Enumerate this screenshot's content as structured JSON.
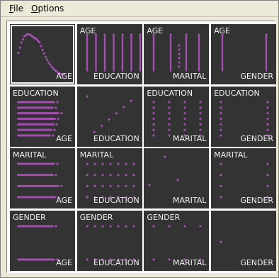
{
  "menu": {
    "file_first": "F",
    "file_rest": "ile",
    "options_first": "O",
    "options_rest": "ptions"
  },
  "point_color": "#a24fb0",
  "cell_bg": "#333333",
  "variables": [
    "AGE",
    "EDUCATION",
    "MARITAL",
    "GENDER"
  ],
  "selected_cell": "AGE-AGE",
  "chart_data": {
    "type": "scatter-matrix",
    "variables": [
      "AGE",
      "EDUCATION",
      "MARITAL",
      "GENDER"
    ],
    "levels": {
      "EDUCATION": [
        1,
        2,
        3,
        4,
        5,
        6,
        7
      ],
      "MARITAL": [
        1,
        2,
        3,
        4
      ],
      "GENDER": [
        1,
        2
      ]
    },
    "age_density_curve": [
      0.55,
      0.8,
      0.95,
      1.0,
      0.98,
      0.92,
      0.88,
      0.8,
      0.62,
      0.45,
      0.32,
      0.22,
      0.14,
      0.08,
      0.05,
      0.03
    ]
  }
}
